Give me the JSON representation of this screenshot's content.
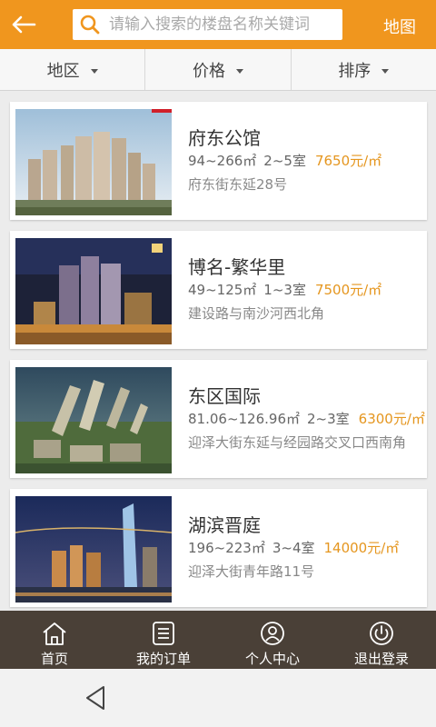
{
  "colors": {
    "accent": "#f0961e",
    "price": "#e5961f",
    "nav_bg": "#4a4037"
  },
  "header": {
    "back_icon": "arrow-left-icon",
    "search_placeholder": "请输入搜索的楼盘名称关键词",
    "search_icon": "search-icon",
    "map_label": "地图"
  },
  "filters": [
    {
      "label": "地区"
    },
    {
      "label": "价格"
    },
    {
      "label": "排序"
    }
  ],
  "listings": [
    {
      "name": "府东公馆",
      "area": "94~266㎡",
      "rooms": "2~5室",
      "price": "7650元/㎡",
      "address": "府东街东延28号"
    },
    {
      "name": "博名-繁华里",
      "area": "49~125㎡",
      "rooms": "1~3室",
      "price": "7500元/㎡",
      "address": "建设路与南沙河西北角"
    },
    {
      "name": "东区国际",
      "area": "81.06~126.96㎡",
      "rooms": "2~3室",
      "price": "6300元/㎡",
      "address": "迎泽大街东延与经园路交叉口西南角"
    },
    {
      "name": "湖滨晋庭",
      "area": "196~223㎡",
      "rooms": "3~4室",
      "price": "14000元/㎡",
      "address": "迎泽大街青年路11号"
    }
  ],
  "bottom_nav": [
    {
      "label": "首页",
      "icon": "home-icon"
    },
    {
      "label": "我的订单",
      "icon": "order-list-icon"
    },
    {
      "label": "个人中心",
      "icon": "user-icon"
    },
    {
      "label": "退出登录",
      "icon": "power-icon"
    }
  ],
  "system": {
    "back_icon": "triangle-back-icon"
  }
}
